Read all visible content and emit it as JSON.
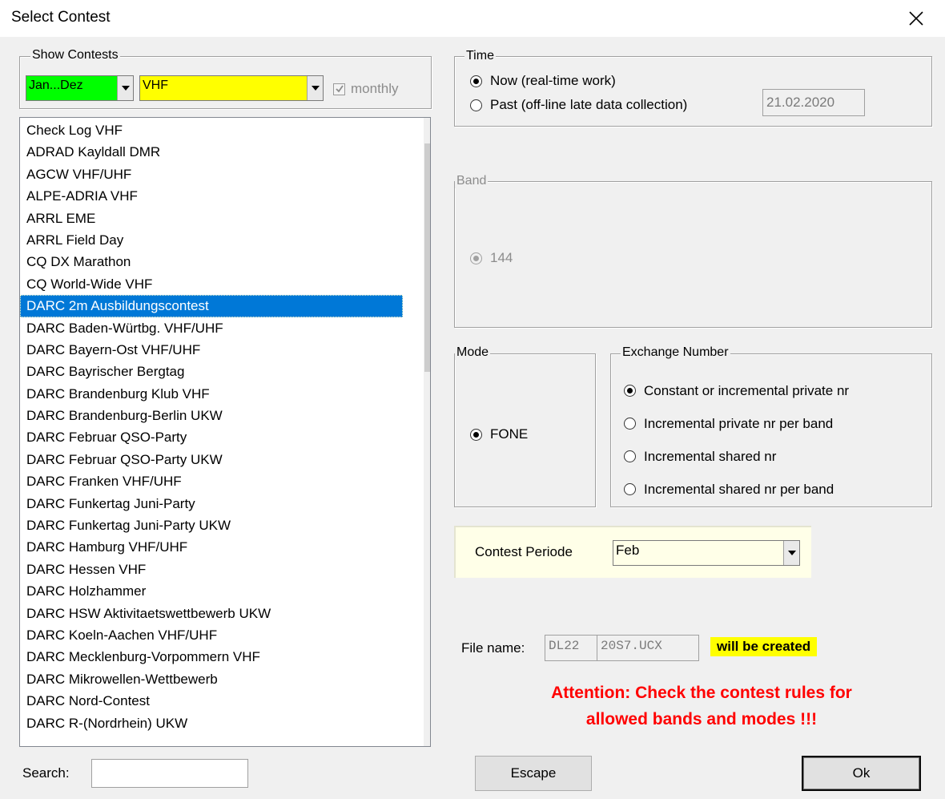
{
  "window": {
    "title": "Select Contest"
  },
  "show_contests": {
    "label": "Show Contests",
    "month_range": "Jan...Dez",
    "month_range_color": "#00ff00",
    "category": "VHF",
    "category_color": "#ffff00",
    "monthly_label": "monthly",
    "monthly_checked": true
  },
  "contest_list": {
    "items": [
      "Check Log VHF",
      "ADRAD Kayldall DMR",
      "AGCW VHF/UHF",
      "ALPE-ADRIA VHF",
      "ARRL EME",
      "ARRL Field Day",
      "CQ DX Marathon",
      "CQ World-Wide VHF",
      "DARC 2m Ausbildungscontest",
      "DARC Baden-Würtbg. VHF/UHF",
      "DARC Bayern-Ost VHF/UHF",
      "DARC Bayrischer Bergtag",
      "DARC Brandenburg Klub VHF",
      "DARC Brandenburg-Berlin UKW",
      "DARC Februar QSO-Party",
      "DARC Februar QSO-Party UKW",
      "DARC Franken VHF/UHF",
      "DARC Funkertag Juni-Party",
      "DARC Funkertag Juni-Party UKW",
      "DARC Hamburg VHF/UHF",
      "DARC Hessen VHF",
      "DARC Holzhammer",
      "DARC HSW Aktivitaetswettbewerb UKW",
      "DARC Koeln-Aachen  VHF/UHF",
      "DARC Mecklenburg-Vorpommern VHF",
      "DARC Mikrowellen-Wettbewerb",
      "DARC Nord-Contest",
      "DARC R-(Nordrhein) UKW"
    ],
    "selected": "DARC 2m Ausbildungscontest",
    "selection_color": "#0078d7"
  },
  "search": {
    "label": "Search:",
    "value": ""
  },
  "time": {
    "label": "Time",
    "now_label": "Now (real-time work)",
    "past_label": "Past (off-line late data collection)",
    "selected": "now",
    "date": "21.02.2020"
  },
  "band": {
    "label": "Band",
    "option": "144"
  },
  "mode": {
    "label": "Mode",
    "option": "FONE"
  },
  "exchange": {
    "label": "Exchange Number",
    "options": [
      "Constant or incremental private nr",
      "Incremental private nr per band",
      "Incremental shared nr",
      "Incremental shared nr per band"
    ],
    "selected_index": 0
  },
  "period": {
    "label": "Contest Periode",
    "value": "Feb",
    "background": "#ffffe8"
  },
  "file": {
    "label": "File name:",
    "prefix": "DL22",
    "name": "20S7.UCX",
    "status": "will be created",
    "status_color": "#ffff00"
  },
  "attention": {
    "line1": "Attention:  Check the contest rules for",
    "line2": "allowed bands and modes !!!",
    "color": "#ff0000"
  },
  "buttons": {
    "escape": "Escape",
    "ok": "Ok"
  }
}
